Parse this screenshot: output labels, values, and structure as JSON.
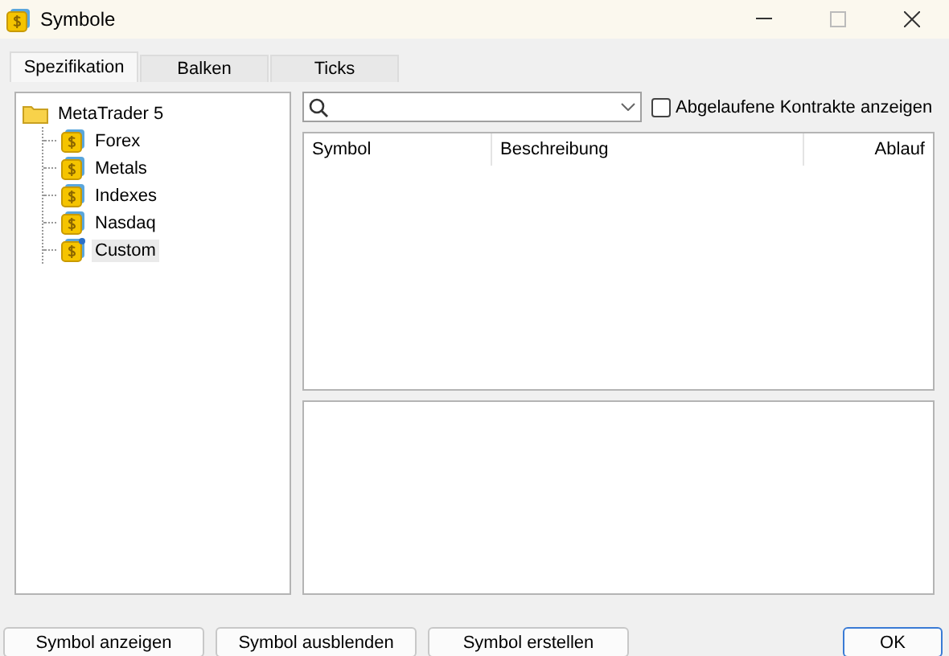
{
  "window": {
    "title": "Symbole"
  },
  "tabs": [
    {
      "label": "Spezifikation",
      "selected": true
    },
    {
      "label": "Balken",
      "selected": false
    },
    {
      "label": "Ticks",
      "selected": false
    }
  ],
  "tree": {
    "label": "MetaTrader 5",
    "children": [
      {
        "label": "Forex",
        "kind": "group",
        "selected": false
      },
      {
        "label": "Metals",
        "kind": "group",
        "selected": false
      },
      {
        "label": "Indexes",
        "kind": "group",
        "selected": false
      },
      {
        "label": "Nasdaq",
        "kind": "group",
        "selected": false
      },
      {
        "label": "Custom",
        "kind": "custom",
        "selected": true
      }
    ]
  },
  "expired_checkbox": {
    "label": "Abgelaufene Kontrakte anzeigen",
    "checked": false
  },
  "table": {
    "columns": [
      "Symbol",
      "Beschreibung",
      "Ablauf"
    ]
  },
  "buttons": [
    "Symbol anzeigen",
    "Symbol ausblenden",
    "Symbol erstellen"
  ],
  "ok_button": "OK"
}
